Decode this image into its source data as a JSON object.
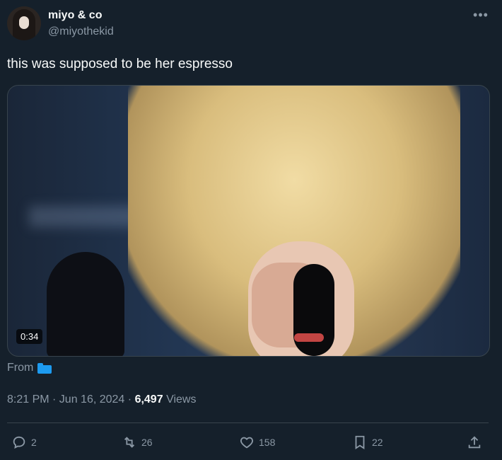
{
  "author": {
    "name": "miyo & co",
    "handle": "@miyothekid"
  },
  "tweet": {
    "text": "this was supposed to be her espresso",
    "media": {
      "duration": "0:34"
    },
    "from_label": "From",
    "timestamp": "8:21 PM · Jun 16, 2024",
    "views_count": "6,497",
    "views_label": "Views"
  },
  "actions": {
    "replies": "2",
    "reposts": "26",
    "likes": "158",
    "bookmarks": "22"
  },
  "icons": {
    "more": "more-icon",
    "reply": "reply-icon",
    "repost": "repost-icon",
    "like": "heart-icon",
    "bookmark": "bookmark-icon",
    "share": "share-icon",
    "folder": "folder-icon"
  },
  "colors": {
    "background": "#15202b",
    "text": "#f7f9f9",
    "secondary": "#8b98a5",
    "accent": "#1d9bf0",
    "border": "#38444d"
  }
}
